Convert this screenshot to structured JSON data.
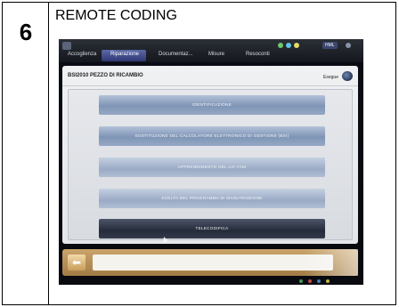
{
  "step": {
    "number": "6",
    "title": "REMOTE CODING"
  },
  "app": {
    "tabs": [
      {
        "label": "Accoglienza"
      },
      {
        "label": "Riparazione"
      },
      {
        "label": "Documentaz..."
      },
      {
        "label": "Misure"
      },
      {
        "label": "Resoconti"
      }
    ],
    "badge": "HML"
  },
  "panel": {
    "title": "BSI2010 PEZZO DI RICAMBIO",
    "exit_label": "Esegue"
  },
  "menu": {
    "items": [
      {
        "label": "IDENTIFICAZIONE"
      },
      {
        "label": "SOSTITUZIONE DEL CALCOLATORE ELETTRONICO DI GESTIONE (BSI)"
      },
      {
        "label": "APPRENDIMENTO DEL LIC FAM"
      },
      {
        "label": "SCELTA DEL PROGRAMMA DI MANUTENZIONE"
      },
      {
        "label": "TELECODIFICA"
      }
    ]
  },
  "colors": {
    "active_tab": "#2e3773",
    "menu_button": "#7f95b6",
    "menu_button_selected": "#252b39",
    "footer": "#a37c45"
  },
  "icons": {
    "back": "arrow-left-icon",
    "exit": "exit-icon"
  }
}
